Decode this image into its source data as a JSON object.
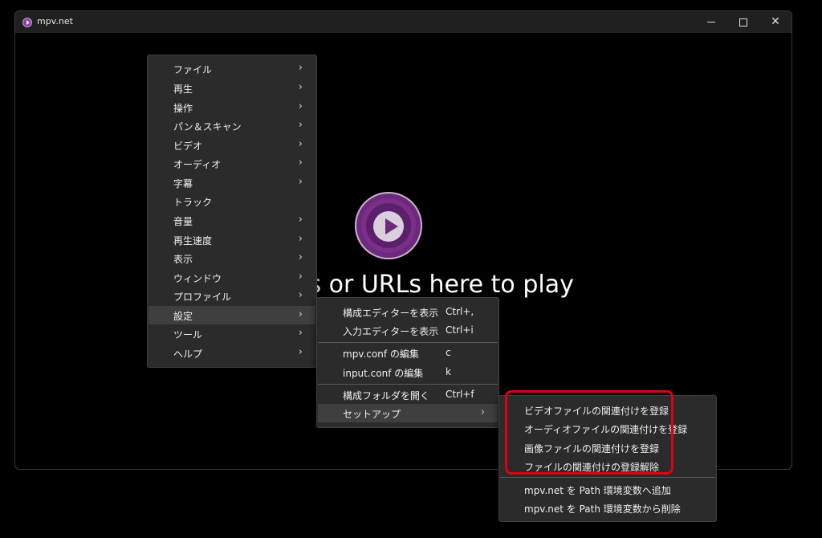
{
  "window": {
    "title": "mpv.net"
  },
  "player": {
    "hint": "es or URLs here to play"
  },
  "main_menu": {
    "items": [
      {
        "label": "ファイル",
        "arrow": "›"
      },
      {
        "label": "再生",
        "arrow": "›"
      },
      {
        "label": "操作",
        "arrow": "›"
      },
      {
        "label": "パン＆スキャン",
        "arrow": "›"
      },
      {
        "label": "ビデオ",
        "arrow": "›"
      },
      {
        "label": "オーディオ",
        "arrow": "›"
      },
      {
        "label": "字幕",
        "arrow": "›"
      },
      {
        "label": "トラック",
        "arrow": ""
      },
      {
        "label": "音量",
        "arrow": "›"
      },
      {
        "label": "再生速度",
        "arrow": "›"
      },
      {
        "label": "表示",
        "arrow": "›"
      },
      {
        "label": "ウィンドウ",
        "arrow": "›"
      },
      {
        "label": "プロファイル",
        "arrow": "›"
      },
      {
        "label": "設定",
        "arrow": "›"
      },
      {
        "label": "ツール",
        "arrow": "›"
      },
      {
        "label": "ヘルプ",
        "arrow": "›"
      }
    ]
  },
  "settings_menu": {
    "items": [
      {
        "label": "構成エディターを表示",
        "shortcut": "Ctrl+,"
      },
      {
        "label": "入力エディターを表示",
        "shortcut": "Ctrl+i"
      },
      {
        "label": "mpv.conf の編集",
        "shortcut": "c"
      },
      {
        "label": "input.conf の編集",
        "shortcut": "k"
      },
      {
        "label": "構成フォルダを開く",
        "shortcut": "Ctrl+f"
      },
      {
        "label": "セットアップ",
        "arrow": "›"
      }
    ]
  },
  "setup_menu": {
    "items": [
      {
        "label": "ビデオファイルの関連付けを登録"
      },
      {
        "label": "オーディオファイルの関連付けを登録"
      },
      {
        "label": "画像ファイルの関連付けを登録"
      },
      {
        "label": "ファイルの関連付けの登録解除"
      },
      {
        "label": "mpv.net を Path 環境変数へ追加"
      },
      {
        "label": "mpv.net を Path 環境変数から削除"
      }
    ]
  },
  "colors": {
    "highlight_border": "#e00012",
    "menu_bg": "#2b2b2b",
    "brand": "#6d2a7d"
  }
}
